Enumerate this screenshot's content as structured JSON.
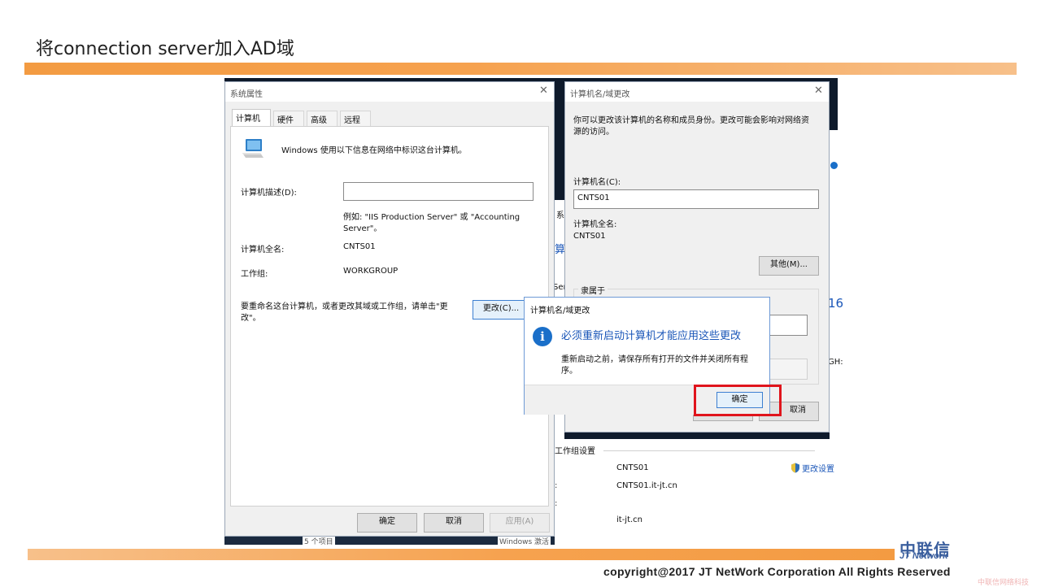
{
  "slide": {
    "title": "将connection server加入AD域",
    "copyright": "copyright@2017  JT NetWork Corporation All Rights Reserved",
    "logo_cn": "中联信",
    "logo_en": "JT Network",
    "watermark": "中联信网络科技"
  },
  "system_props": {
    "title": "系统属性",
    "tabs": [
      "计算机名",
      "硬件",
      "高级",
      "远程"
    ],
    "intro": "Windows 使用以下信息在网络中标识这台计算机。",
    "desc_label": "计算机描述(D):",
    "desc_value": "",
    "example_line1": "例如: \"IIS Production Server\" 或 \"Accounting",
    "example_line2": "Server\"。",
    "fullname_label": "计算机全名:",
    "fullname_value": "CNTS01",
    "workgroup_label": "工作组:",
    "workgroup_value": "WORKGROUP",
    "rename_line1": "要重命名这台计算机，或者更改其域或工作组，请单击\"更",
    "rename_line2": "改\"。",
    "change_btn": "更改(C)...",
    "ok_btn": "确定",
    "cancel_btn": "取消",
    "apply_btn": "应用(A)"
  },
  "name_change": {
    "title": "计算机名/域更改",
    "desc_line1": "你可以更改该计算机的名称和成员身份。更改可能会影响对网络资",
    "desc_line2": "源的访问。",
    "name_label": "计算机名(C):",
    "name_value": "CNTS01",
    "fullname_label": "计算机全名:",
    "fullname_value": "CNTS01",
    "other_btn": "其他(M)...",
    "member_label": "隶属于",
    "cancel_btn": "取消"
  },
  "bg_window": {
    "partial_1": "系",
    "partial_2": "算",
    "partial_3": "Ser",
    "partial_4": "16",
    "partial_5": "GH:",
    "section_label": "工作组设置",
    "computer_name": "CNTS01",
    "full_name": "CNTS01.it-jt.cn",
    "domain": "it-jt.cn",
    "change_settings": "更改设置",
    "items_count": "5 个项目",
    "activation": "Windows 激活"
  },
  "restart_msg": {
    "title": "计算机名/域更改",
    "heading": "必须重新启动计算机才能应用这些更改",
    "body_line1": "重新启动之前，请保存所有打开的文件并关闭所有程",
    "body_line2": "序。",
    "ok_btn": "确定"
  },
  "colors": {
    "highlight_box": "#e0141c",
    "info_icon": "#1a6fc9",
    "heading_text": "#1a56b8"
  }
}
